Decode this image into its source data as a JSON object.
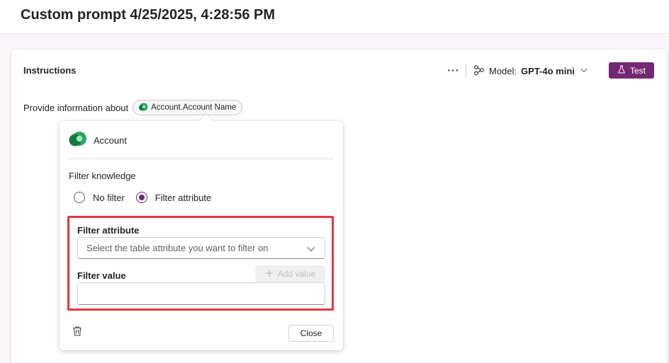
{
  "header": {
    "title": "Custom prompt 4/25/2025, 4:28:56 PM"
  },
  "card": {
    "title": "Instructions",
    "more_label": "···",
    "model_label": "Model:",
    "model_value": "GPT-4o mini",
    "test_label": "Test"
  },
  "prompt": {
    "text": "Provide information about",
    "chip_label": "Account.Account Name"
  },
  "popover": {
    "entity_name": "Account",
    "filter_knowledge_label": "Filter knowledge",
    "radio_options": [
      {
        "label": "No filter",
        "checked": false
      },
      {
        "label": "Filter attribute",
        "checked": true
      }
    ],
    "filter_attribute_label": "Filter attribute",
    "filter_attribute_placeholder": "Select the table attribute you want to filter on",
    "filter_value_label": "Filter value",
    "filter_value": "",
    "add_value_label": "Add value",
    "close_label": "Close"
  },
  "colors": {
    "accent": "#742774",
    "highlight": "#e8363f",
    "dataverse_green": "#107c41"
  },
  "icons": [
    "flow-icon",
    "chevron-down-icon",
    "flask-icon",
    "dataverse-icon",
    "plus-icon",
    "trash-icon"
  ]
}
